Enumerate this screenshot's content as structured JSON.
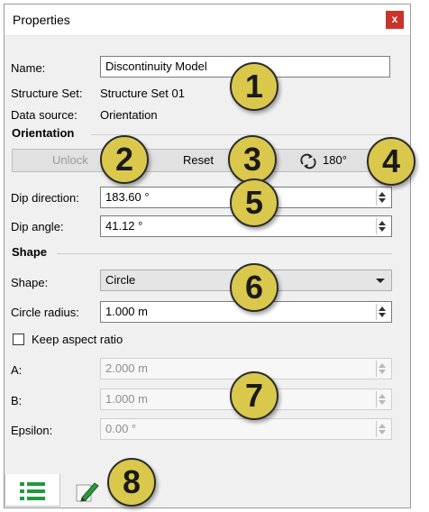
{
  "window": {
    "title": "Properties",
    "close_glyph": "x"
  },
  "fields": {
    "name_label": "Name:",
    "name_value": "Discontinuity Model",
    "structure_set_label": "Structure Set:",
    "structure_set_value": "Structure Set 01",
    "data_source_label": "Data source:",
    "data_source_value": "Orientation"
  },
  "orientation": {
    "heading": "Orientation",
    "unlock_label": "Unlock",
    "reset_label": "Reset",
    "rotate_label": "180°",
    "rotate_icon": "rotate-icon",
    "dip_direction_label": "Dip direction:",
    "dip_direction_value": "183.60 °",
    "dip_angle_label": "Dip angle:",
    "dip_angle_value": "41.12 °"
  },
  "shape": {
    "heading": "Shape",
    "shape_label": "Shape:",
    "shape_value": "Circle",
    "circle_radius_label": "Circle radius:",
    "circle_radius_value": "1.000 m",
    "keep_aspect_label": "Keep aspect ratio",
    "keep_aspect_checked": false,
    "a_label": "A:",
    "a_value": "2.000 m",
    "b_label": "B:",
    "b_value": "1.000 m",
    "epsilon_label": "Epsilon:",
    "epsilon_value": "0.00 °"
  },
  "tabs": [
    {
      "icon": "list-icon",
      "active": true
    },
    {
      "icon": "edit-pencil-icon",
      "active": false
    }
  ],
  "callouts": [
    "1",
    "2",
    "3",
    "4",
    "5",
    "6",
    "7",
    "8"
  ],
  "colors": {
    "callout_fill": "#d9c84c",
    "close_button": "#c8342a",
    "list_icon": "#1e9a3c"
  }
}
